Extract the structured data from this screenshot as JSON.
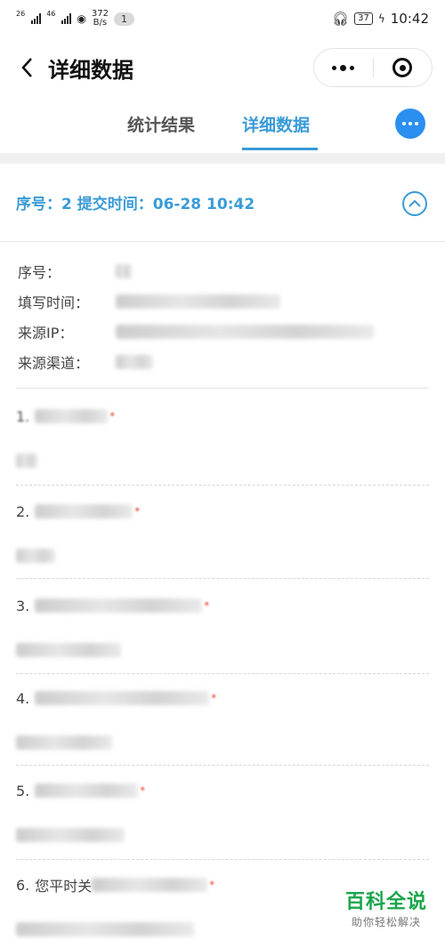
{
  "status_bar": {
    "sig1": "26",
    "sig2": "46",
    "speed_value": "372",
    "speed_unit": "B/s",
    "notification_count": "1",
    "battery": "37",
    "time": "10:42"
  },
  "header": {
    "title": "详细数据"
  },
  "tabs": {
    "stats": "统计结果",
    "detail": "详细数据",
    "active": "detail"
  },
  "record": {
    "header_text": "序号：2  提交时间：06-28 10:42"
  },
  "meta": {
    "seq_label": "序号：",
    "time_label": "填写时间：",
    "ip_label": "来源IP：",
    "channel_label": "来源渠道："
  },
  "questions": [
    {
      "num": "1.",
      "required_mark": "*"
    },
    {
      "num": "2.",
      "required_mark": "*"
    },
    {
      "num": "3.",
      "required_mark": "*"
    },
    {
      "num": "4.",
      "required_mark": "*"
    },
    {
      "num": "5.",
      "required_mark": "*"
    },
    {
      "num": "6.",
      "title_fragment": "您平时关",
      "required_mark": "*"
    }
  ],
  "watermark": {
    "brand": "百科全说",
    "slogan": "助你轻松解决"
  },
  "colors": {
    "accent": "#3a9bd8",
    "fab": "#2b8ff0",
    "watermark": "#1aa64b",
    "required": "#e74c3c"
  }
}
